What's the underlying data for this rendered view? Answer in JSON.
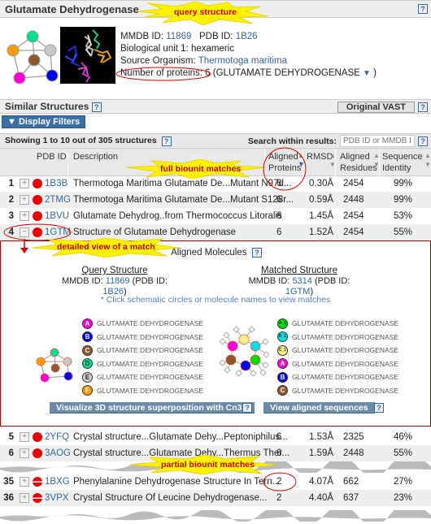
{
  "title_bar": {
    "title": "Glutamate Dehydrogenase",
    "help": "?"
  },
  "callouts": {
    "query_structure": "query structure",
    "full_biounit": "full biounit matches",
    "detailed_view": "detailed view of a match",
    "partial_biounit": "partial biounit matches"
  },
  "query": {
    "mmdb_label": "MMDB ID:",
    "mmdb_id": "11869",
    "pdb_label": "PDB ID:",
    "pdb_id": "1B26",
    "biounit": "Biological unit 1:  hexameric",
    "organism_label": "Source Organism:",
    "organism": "Thermotoga maritima",
    "proteins_label": "Number of proteins: 6",
    "proteins_name": "(GLUTAMATE DEHYDROGENASE",
    "proteins_close": ")",
    "node_colors": [
      "#00e090",
      "#ff9900",
      "#c8c8c8",
      "#8b5a2b",
      "#ff00dd",
      "#0000ee"
    ]
  },
  "similar": {
    "title": "Similar Structures",
    "help": "?",
    "original_vast": "Original VAST",
    "display_filters": "▼ Display Filters",
    "showing": "Showing 1 to 10 out of 305 structures",
    "search_label": "Search within results:",
    "search_placeholder": "PDB ID or MMDB ID",
    "sort_hint": "Sort by column"
  },
  "columns": {
    "pdb": "PDB ID",
    "desc": "Description",
    "aligned_proteins_1": "Aligned",
    "aligned_proteins_2": "Proteins",
    "rmsd": "RMSD",
    "aligned_residues_1": "Aligned",
    "aligned_residues_2": "Residues",
    "seq_identity_1": "Sequence",
    "seq_identity_2": "Identity"
  },
  "rows": [
    {
      "rank": "1",
      "expand": "+",
      "pdb": "1B3B",
      "desc": "Thermotoga Maritima Glutamate De...Mutant N97d...",
      "aligned_proteins": "6",
      "rmsd": "0.30Å",
      "residues": "2454",
      "identity": "99%",
      "match": "full"
    },
    {
      "rank": "2",
      "expand": "+",
      "pdb": "2TMG",
      "desc": "Thermotoga Maritima Glutamate De...Mutant S128r...",
      "aligned_proteins": "6",
      "rmsd": "0.59Å",
      "residues": "2448",
      "identity": "99%",
      "match": "full"
    },
    {
      "rank": "3",
      "expand": "+",
      "pdb": "1BVU",
      "desc": "Glutamate Dehydrog..from Thermococcus Litoralis",
      "aligned_proteins": "6",
      "rmsd": "1.45Å",
      "residues": "2454",
      "identity": "53%",
      "match": "full"
    },
    {
      "rank": "4",
      "expand": "−",
      "pdb": "1GTM",
      "desc": "Structure of Glutamate Dehydrogenase",
      "aligned_proteins": "6",
      "rmsd": "1.52Å",
      "residues": "2454",
      "identity": "55%",
      "match": "full"
    },
    {
      "rank": "5",
      "expand": "+",
      "pdb": "2YFQ",
      "desc": "Crystal structure...Glutamate Dehy...Peptoniphilus...",
      "aligned_proteins": "6",
      "rmsd": "1.53Å",
      "residues": "2325",
      "identity": "46%",
      "match": "full"
    },
    {
      "rank": "6",
      "expand": "+",
      "pdb": "3AOG",
      "desc": "Crystal structure...Glutamate Dehy...Thermus Ther...",
      "aligned_proteins": "6",
      "rmsd": "1.59Å",
      "residues": "2448",
      "identity": "55%",
      "match": "full"
    },
    {
      "rank": "35",
      "expand": "+",
      "pdb": "1BXG",
      "desc": "Phenylalanine Dehydrogenase Structure In Tern...",
      "aligned_proteins": "2",
      "rmsd": "4.07Å",
      "residues": "662",
      "identity": "27%",
      "match": "partial"
    },
    {
      "rank": "36",
      "expand": "+",
      "pdb": "3VPX",
      "desc": "Crystal Structure Of Leucine Dehydrogenase...",
      "aligned_proteins": "2",
      "rmsd": "4.40Å",
      "residues": "637",
      "identity": "23%",
      "match": "partial"
    }
  ],
  "detail": {
    "heading": "Aligned Molecules",
    "help": "?",
    "query_title": "Query Structure",
    "query_mmdb_label": "MMDB ID:",
    "query_mmdb": "11869",
    "query_pdb_label": "(PDB ID:",
    "query_pdb": "1B26",
    "query_close": ")",
    "matched_title": "Matched Structure",
    "matched_mmdb_label": "MMDB ID:",
    "matched_mmdb": "5314",
    "matched_pdb_label": "(PDB ID:",
    "matched_pdb": "1GTM",
    "matched_close": ")",
    "hint": "* Click schematic circles or molecule names to view matches",
    "query_molecules": [
      {
        "chain": "A",
        "name": "GLUTAMATE DEHYDROGENASE",
        "color": "#ff00dd"
      },
      {
        "chain": "B",
        "name": "GLUTAMATE DEHYDROGENASE",
        "color": "#0000ee"
      },
      {
        "chain": "C",
        "name": "GLUTAMATE DEHYDROGENASE",
        "color": "#8b5a2b"
      },
      {
        "chain": "D",
        "name": "GLUTAMATE DEHYDROGENASE",
        "color": "#00e090"
      },
      {
        "chain": "E",
        "name": "GLUTAMATE DEHYDROGENASE",
        "color": "#d0d0d0"
      },
      {
        "chain": "F",
        "name": "GLUTAMATE DEHYDROGENASE",
        "color": "#ff9900"
      }
    ],
    "matched_molecules": [
      {
        "chain": "A_1",
        "name": "GLUTAMATE DEHYDROGENASE",
        "color": "#00dd00"
      },
      {
        "chain": "B_1",
        "name": "GLUTAMATE DEHYDROGENASE",
        "color": "#00e0e0"
      },
      {
        "chain": "C_1",
        "name": "GLUTAMATE DEHYDROGENASE",
        "color": "#ffee88"
      },
      {
        "chain": "A",
        "name": "GLUTAMATE DEHYDROGENASE",
        "color": "#ff00dd"
      },
      {
        "chain": "B",
        "name": "GLUTAMATE DEHYDROGENASE",
        "color": "#0000ee"
      },
      {
        "chain": "C",
        "name": "GLUTAMATE DEHYDROGENASE",
        "color": "#8b5a2b"
      }
    ],
    "cn3d_button": "Visualize 3D structure superposition with Cn3D",
    "sequences_button": "View aligned sequences"
  }
}
